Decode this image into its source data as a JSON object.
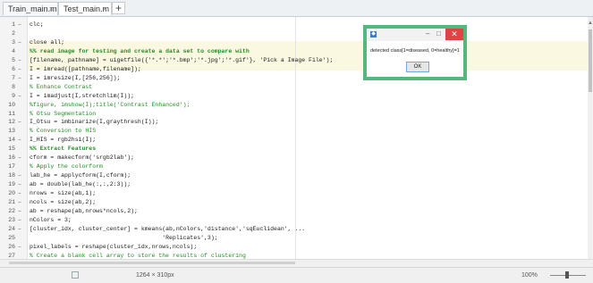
{
  "tabs": [
    {
      "label": "Train_main.m",
      "close": "×"
    },
    {
      "label": "Test_main.m",
      "close": "×"
    }
  ],
  "tab_add": "+",
  "editor": {
    "lines": [
      {
        "num": "1",
        "dash": "–",
        "text": "clc;",
        "style": "code"
      },
      {
        "num": "2",
        "dash": "",
        "text": "",
        "style": "code"
      },
      {
        "num": "3",
        "dash": "–",
        "text": "close all;",
        "style": "code"
      },
      {
        "num": "4",
        "dash": "",
        "text": "%% read image for testing and create a data set to compare with",
        "style": "cell"
      },
      {
        "num": "5",
        "dash": "–",
        "text": "[filename, pathname] = uigetfile({'*.*';'*.bmp';'*.jpg';'*.gif'}, 'Pick a Image File');",
        "style": "code"
      },
      {
        "num": "6",
        "dash": "–",
        "text": "I = imread([pathname,filename]);",
        "style": "code"
      },
      {
        "num": "7",
        "dash": "–",
        "text": "I = imresize(I,[256,256]);",
        "style": "code"
      },
      {
        "num": "8",
        "dash": "",
        "text": "% Enhance Contrast",
        "style": "comment"
      },
      {
        "num": "9",
        "dash": "–",
        "text": "I = imadjust(I,stretchlim(I));",
        "style": "code"
      },
      {
        "num": "10",
        "dash": "",
        "text": "%figure, imshow(I);title('Contrast Enhanced');",
        "style": "comment"
      },
      {
        "num": "11",
        "dash": "",
        "text": "% Otsu Segmentation",
        "style": "comment"
      },
      {
        "num": "12",
        "dash": "–",
        "text": "I_Otsu = imbinarize(I,graythresh(I));",
        "style": "code"
      },
      {
        "num": "13",
        "dash": "",
        "text": "% Conversion to HIS",
        "style": "comment"
      },
      {
        "num": "14",
        "dash": "–",
        "text": "I_HIS = rgb2hsi(I);",
        "style": "code"
      },
      {
        "num": "15",
        "dash": "",
        "text": "%% Extract Features",
        "style": "cell"
      },
      {
        "num": "16",
        "dash": "–",
        "text": "cform = makecform('srgb2lab');",
        "style": "code"
      },
      {
        "num": "17",
        "dash": "",
        "text": "% Apply the colorform",
        "style": "comment"
      },
      {
        "num": "18",
        "dash": "–",
        "text": "lab_he = applycform(I,cform);",
        "style": "code"
      },
      {
        "num": "19",
        "dash": "–",
        "text": "ab = double(lab_he(:,:,2:3));",
        "style": "code"
      },
      {
        "num": "20",
        "dash": "–",
        "text": "nrows = size(ab,1);",
        "style": "code"
      },
      {
        "num": "21",
        "dash": "–",
        "text": "ncols = size(ab,2);",
        "style": "code"
      },
      {
        "num": "22",
        "dash": "–",
        "text": "ab = reshape(ab,nrows*ncols,2);",
        "style": "code"
      },
      {
        "num": "23",
        "dash": "–",
        "text": "nColors = 3;",
        "style": "code"
      },
      {
        "num": "24",
        "dash": "–",
        "text": "[cluster_idx, cluster_center] = kmeans(ab,nColors,'distance','sqEuclidean', ...",
        "style": "code"
      },
      {
        "num": "25",
        "dash": "",
        "text": "                                      'Replicates',3);",
        "style": "code"
      },
      {
        "num": "26",
        "dash": "–",
        "text": "pixel_labels = reshape(cluster_idx,nrows,ncols);",
        "style": "code"
      },
      {
        "num": "27",
        "dash": "",
        "text": "% Create a blank cell array to store the results of clustering",
        "style": "comment"
      }
    ]
  },
  "dialog": {
    "message": "detected class[1=diseased, 0=healthy]=1",
    "ok_label": "OK",
    "minimize": "–",
    "maximize": "□",
    "close": "✕"
  },
  "statusbar": {
    "dimensions": "1264 × 310px",
    "zoom": "100%"
  },
  "colors": {
    "dialog_border": "#54b77d",
    "close_button": "#e04343",
    "comment": "#228b22"
  }
}
